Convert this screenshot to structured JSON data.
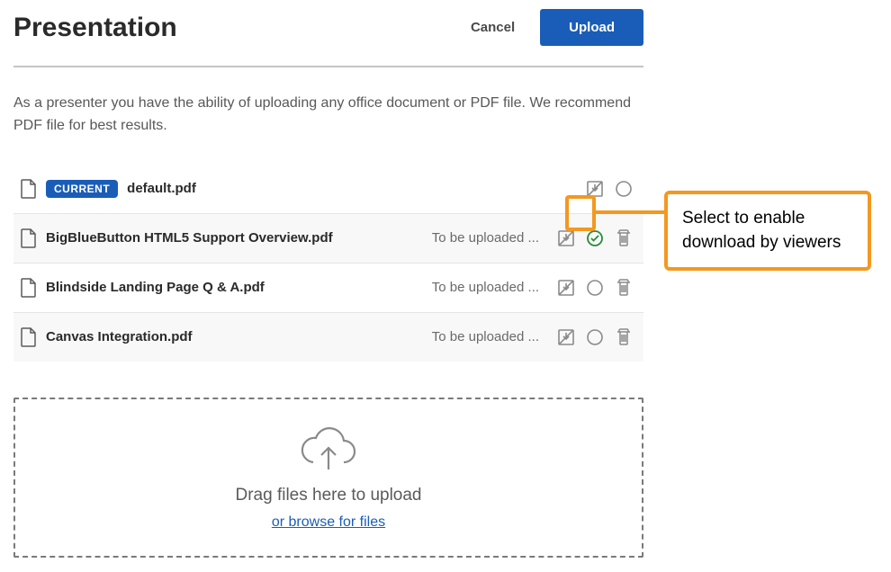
{
  "header": {
    "title": "Presentation",
    "cancel_label": "Cancel",
    "upload_label": "Upload"
  },
  "description": "As a presenter you have the ability of uploading any office document or PDF file. We recommend PDF file for best results.",
  "files": [
    {
      "name": "default.pdf",
      "badge": "CURRENT",
      "status": "",
      "show_delete": false,
      "checked": false
    },
    {
      "name": "BigBlueButton HTML5 Support Overview.pdf",
      "badge": "",
      "status": "To be uploaded ...",
      "show_delete": true,
      "checked": true
    },
    {
      "name": "Blindside Landing Page Q & A.pdf",
      "badge": "",
      "status": "To be uploaded ...",
      "show_delete": true,
      "checked": false
    },
    {
      "name": "Canvas Integration.pdf",
      "badge": "",
      "status": "To be uploaded ...",
      "show_delete": true,
      "checked": false
    }
  ],
  "dropzone": {
    "title": "Drag files here to upload",
    "link": "or browse for files"
  },
  "callout": {
    "text": "Select to enable download by viewers"
  },
  "icons": {
    "file": "file-icon",
    "download_disabled": "download-disabled-icon",
    "circle": "circle-icon",
    "check_circle": "check-circle-icon",
    "trash": "trash-icon",
    "cloud_upload": "cloud-upload-icon"
  }
}
